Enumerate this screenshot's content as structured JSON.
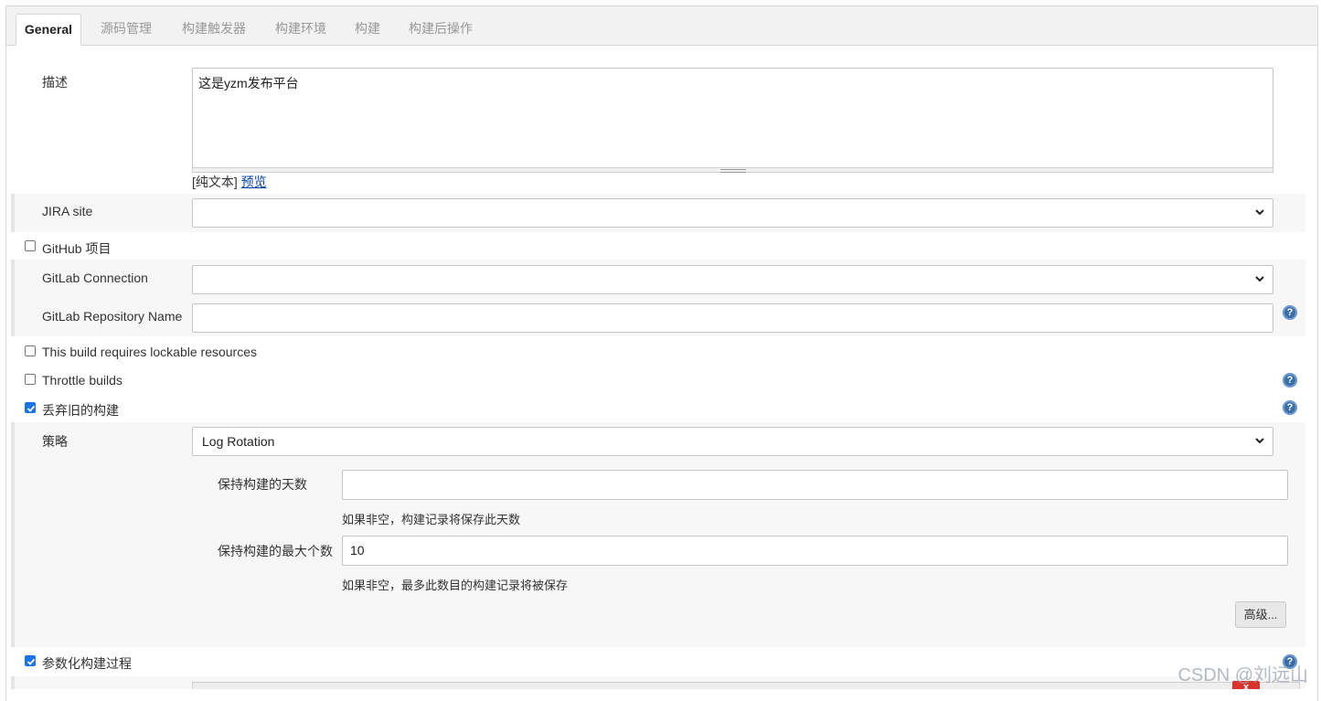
{
  "tabs": [
    {
      "label": "General",
      "active": true
    },
    {
      "label": "源码管理"
    },
    {
      "label": "构建触发器"
    },
    {
      "label": "构建环境"
    },
    {
      "label": "构建"
    },
    {
      "label": "构建后操作"
    }
  ],
  "description": {
    "label": "描述",
    "value": "这是yzm发布平台",
    "format_prefix": "[纯文本]",
    "preview_link": "预览"
  },
  "jira": {
    "label": "JIRA site",
    "value": ""
  },
  "github_project": {
    "label": "GitHub 项目",
    "checked": false
  },
  "gitlab_connection": {
    "label": "GitLab Connection",
    "value": ""
  },
  "gitlab_repo": {
    "label": "GitLab Repository Name",
    "value": ""
  },
  "lockable": {
    "label": "This build requires lockable resources",
    "checked": false
  },
  "throttle": {
    "label": "Throttle builds",
    "checked": false
  },
  "discard_old": {
    "label": "丢弃旧的构建",
    "checked": true
  },
  "strategy": {
    "label": "策略",
    "value": "Log Rotation"
  },
  "days_to_keep": {
    "label": "保持构建的天数",
    "value": "",
    "hint": "如果非空，构建记录将保存此天数"
  },
  "max_builds": {
    "label": "保持构建的最大个数",
    "value": "10",
    "hint": "如果非空，最多此数目的构建记录将被保存"
  },
  "advanced_button": "高级...",
  "parameterized": {
    "label": "参数化构建过程",
    "checked": true
  },
  "delete_glyph": "x",
  "help_glyph": "?",
  "watermark": "CSDN @刘远山",
  "colors": {
    "accent": "#1a73e8",
    "help": "#3a6ea5",
    "delete": "#d9342b"
  }
}
